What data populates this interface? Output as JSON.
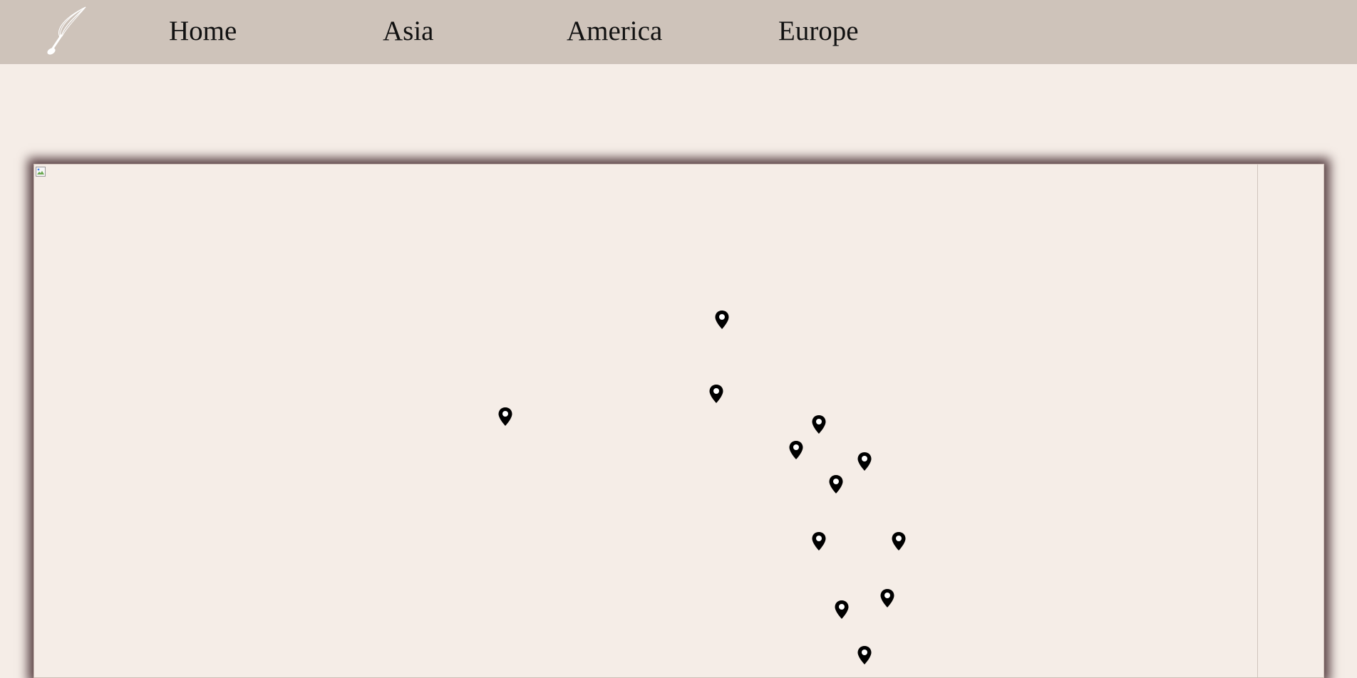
{
  "nav": {
    "logo_icon": "whisk-icon",
    "items": [
      {
        "label": "Home"
      },
      {
        "label": "Asia"
      },
      {
        "label": "America"
      },
      {
        "label": "Europe"
      }
    ]
  },
  "map": {
    "image_icon": "broken-image-icon",
    "marker_icon": "map-pin-icon",
    "marker_count": 13
  },
  "colors": {
    "nav_background": "#cec3ba",
    "page_background": "#f5ede7",
    "frame_shadow": "#5a4245",
    "marker": "#000000"
  }
}
